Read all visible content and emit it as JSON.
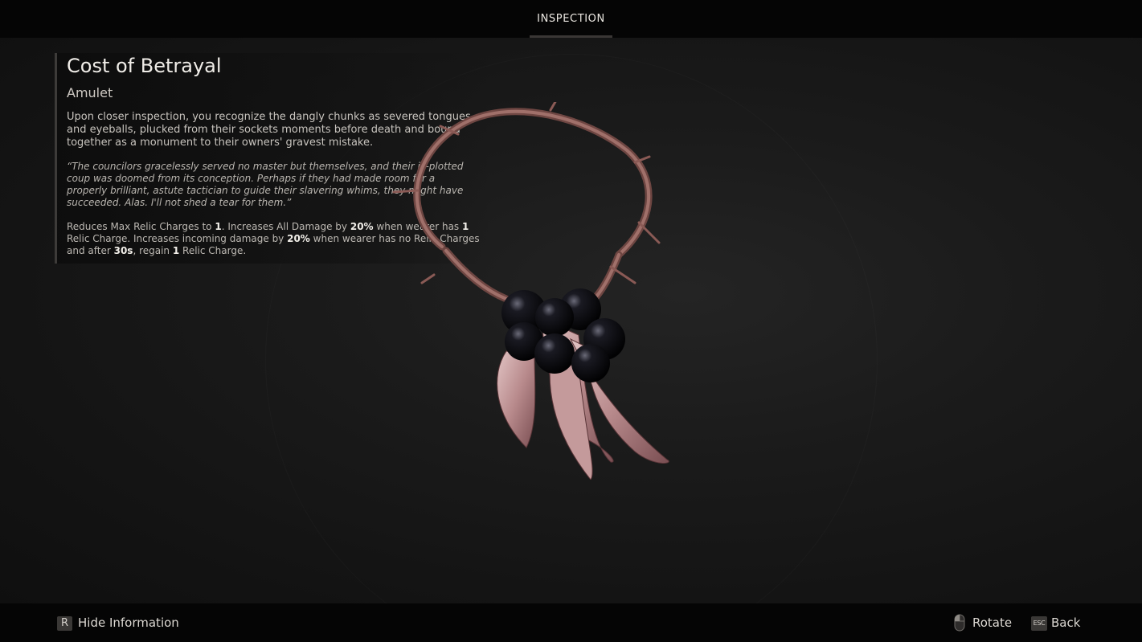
{
  "header": {
    "tab_label": "INSPECTION"
  },
  "item": {
    "name": "Cost of Betrayal",
    "type": "Amulet",
    "description": "Upon closer inspection, you recognize the dangly chunks as severed tongues and eyeballs, plucked from their sockets moments before death and bound together as a monument to their owners' gravest mistake.",
    "quote": "“The councilors gracelessly served no master but themselves, and their ill-plotted coup was doomed from its conception. Perhaps if they had made room for a properly brilliant, astute tactician to guide their slavering whims, they might have succeeded. Alas. I'll not shed a tear for them.”",
    "effect": {
      "t1": "Reduces Max Relic Charges to ",
      "v1": "1",
      "t2": ". Increases All Damage by ",
      "v2": "20%",
      "t3": " when wearer has ",
      "v3": "1",
      "t4": " Relic Charge. Increases incoming damage by ",
      "v4": "20%",
      "t5": " when wearer has no Relic Charges and after ",
      "v5": "30s",
      "t6": ", regain ",
      "v6": "1",
      "t7": " Relic Charge."
    }
  },
  "footer": {
    "hide_key": "R",
    "hide_label": "Hide Information",
    "rotate_icon": "mouse-icon",
    "rotate_label": "Rotate",
    "back_key": "ESC",
    "back_label": "Back"
  },
  "colors": {
    "flesh": "#c9a2a2",
    "eyeball": "#0b0b0f",
    "branch": "#8a5a55"
  }
}
